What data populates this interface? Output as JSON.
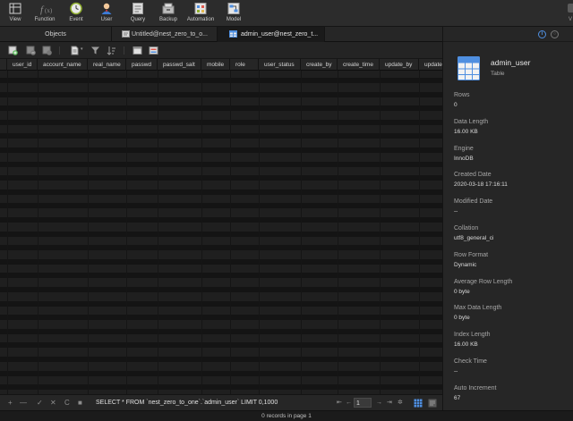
{
  "toolbar": {
    "items": [
      {
        "label": "View",
        "icon": "view-icon"
      },
      {
        "label": "Function",
        "icon": "function-icon"
      },
      {
        "label": "Event",
        "icon": "event-icon"
      },
      {
        "label": "User",
        "icon": "user-icon"
      },
      {
        "label": "Query",
        "icon": "query-icon"
      },
      {
        "label": "Backup",
        "icon": "backup-icon"
      },
      {
        "label": "Automation",
        "icon": "automation-icon"
      },
      {
        "label": "Model",
        "icon": "model-icon"
      }
    ],
    "right_label": "V"
  },
  "tabs": [
    {
      "label": "Objects"
    },
    {
      "label": "Untitled@nest_zero_to_o..."
    },
    {
      "label": "admin_user@nest_zero_t..."
    }
  ],
  "grid": {
    "columns": [
      "user_id",
      "account_name",
      "real_name",
      "passwd",
      "passwd_salt",
      "mobile",
      "role",
      "user_status",
      "create_by",
      "create_time",
      "update_by",
      "update"
    ]
  },
  "bottom": {
    "add": "+",
    "remove": "—",
    "apply": "✓",
    "discard": "✕",
    "refresh": "C",
    "stop": "■",
    "sql": "SELECT * FROM `nest_zero_to_one`.`admin_user` LIMIT 0,1000",
    "first": "⇤",
    "prev": "←",
    "page": "1",
    "next": "→",
    "last": "⇥",
    "settings": "✲"
  },
  "status": "0 records in page 1",
  "panel": {
    "title": "admin_user",
    "subtitle": "Table",
    "props": [
      {
        "label": "Rows",
        "value": "0"
      },
      {
        "label": "Data Length",
        "value": "16.00 KB"
      },
      {
        "label": "Engine",
        "value": "InnoDB"
      },
      {
        "label": "Created Date",
        "value": "2020-03-18 17:16:11"
      },
      {
        "label": "Modified Date",
        "value": "--"
      },
      {
        "label": "Collation",
        "value": "utf8_general_ci"
      },
      {
        "label": "Row Format",
        "value": "Dynamic"
      },
      {
        "label": "Average Row Length",
        "value": "0 byte"
      },
      {
        "label": "Max Data Length",
        "value": "0 byte"
      },
      {
        "label": "Index Length",
        "value": "16.00 KB"
      },
      {
        "label": "Check Time",
        "value": "--"
      },
      {
        "label": "Auto Increment",
        "value": "67"
      }
    ]
  },
  "colors": {
    "accent": "#4f8fe0",
    "background": "#1e1e1e",
    "panel": "#262626"
  }
}
